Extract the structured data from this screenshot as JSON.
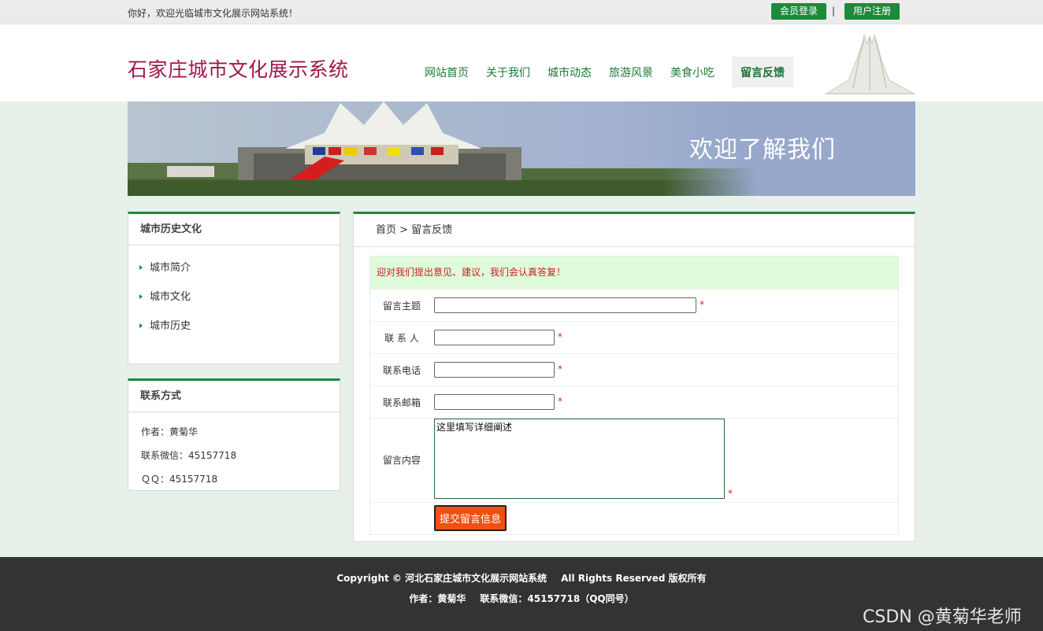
{
  "topbar": {
    "welcome": "你好，欢迎光临城市文化展示网站系统！",
    "login_label": "会员登录",
    "separator": "|",
    "register_label": "用户注册"
  },
  "header": {
    "site_title": "石家庄城市文化展示系统",
    "nav": [
      {
        "label": "网站首页",
        "active": false
      },
      {
        "label": "关于我们",
        "active": false
      },
      {
        "label": "城市动态",
        "active": false
      },
      {
        "label": "旅游风景",
        "active": false
      },
      {
        "label": "美食小吃",
        "active": false
      },
      {
        "label": "留言反馈",
        "active": true
      }
    ]
  },
  "banner": {
    "text": "欢迎了解我们"
  },
  "sidebar": {
    "history_title": "城市历史文化",
    "items": [
      {
        "label": "城市简介"
      },
      {
        "label": "城市文化"
      },
      {
        "label": "城市历史"
      }
    ],
    "contact_title": "联系方式",
    "contact": {
      "author": "作者：黄菊华",
      "wechat": "联系微信：45157718",
      "qq": "ＱＱ：45157718"
    }
  },
  "main": {
    "breadcrumb": "首页 > 留言反馈",
    "notice": "迎对我们提出意见、建议，我们会认真答复！",
    "fields": {
      "subject_label": "留言主题",
      "contact_label": "联 系 人",
      "phone_label": "联系电话",
      "email_label": "联系邮箱",
      "content_label": "留言内容",
      "content_value": "这里填写详细阐述",
      "required_mark": "*"
    },
    "submit_label": "提交留言信息"
  },
  "footer": {
    "copyright": "Copyright © 河北石家庄城市文化展示网站系统",
    "rights": "All Rights Reserved 版权所有",
    "author": "作者：黄菊华",
    "wechat": "联系微信：45157718（QQ同号）",
    "watermark": "CSDN @黄菊华老师"
  },
  "colors": {
    "brand_green": "#1c8a3b",
    "title_red": "#a0184a",
    "submit_orange": "#f24f12",
    "notice_bg": "#e0fbdc",
    "footer_bg": "#333333"
  }
}
